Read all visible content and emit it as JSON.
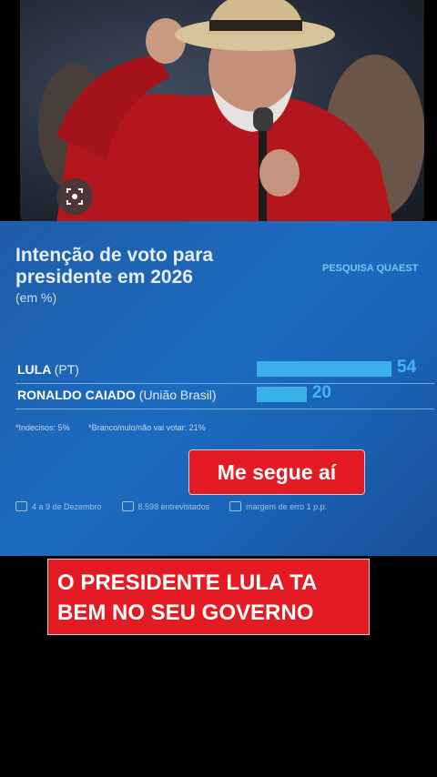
{
  "chart_data": {
    "type": "bar",
    "title": "Intenção de voto para presidente em 2026",
    "subtitle": "(em %)",
    "source": "PESQUISA QUAEST",
    "orientation": "horizontal",
    "categories": [
      "LULA",
      "RONALDO CAIADO"
    ],
    "parties": [
      "(PT)",
      "(União Brasil)"
    ],
    "values": [
      54,
      20
    ],
    "xlim": [
      0,
      54
    ],
    "grid": false,
    "notes": [
      "*Indecisos: 5%",
      "*Branco/nulo/não vai votar: 21%"
    ],
    "bar_color": "#3ab0ea"
  },
  "footer": {
    "dates": "4 a 9 de Dezembro",
    "interviewed": "8.598 entrevistados",
    "margin": "margem de erro 1 p.p."
  },
  "stickers": {
    "follow": "Me segue aí",
    "caption": "O PRESIDENTE LULA TA BEM NO SEU GOVERNO"
  },
  "colors": {
    "panel": "#1c6bc0",
    "sticker": "#e41b23"
  }
}
